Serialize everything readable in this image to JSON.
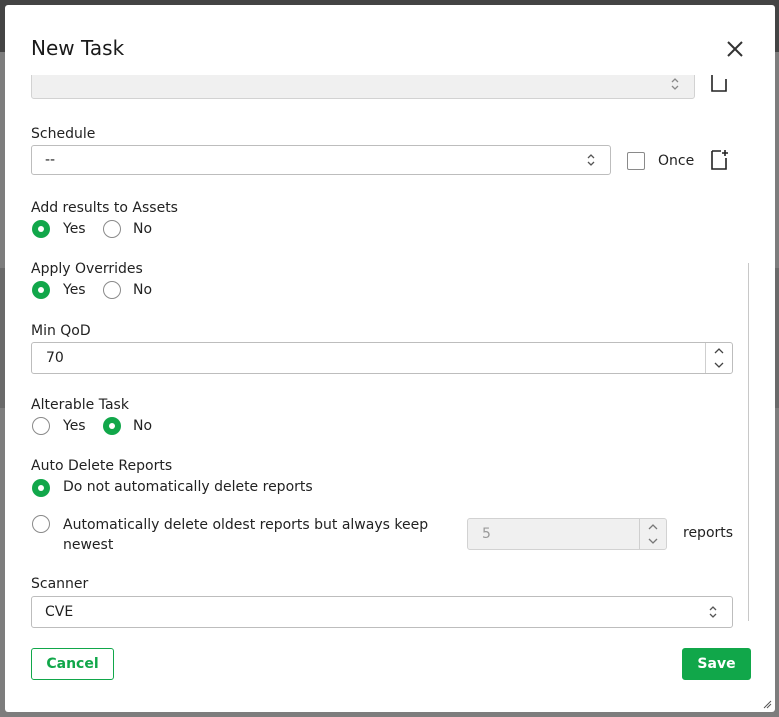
{
  "dialog": {
    "title": "New Task",
    "close_icon": "close-icon"
  },
  "fields": {
    "top_select": {
      "value": ""
    },
    "schedule": {
      "label": "Schedule",
      "value": "--",
      "once_label": "Once",
      "once_checked": false
    },
    "add_results": {
      "label": "Add results to Assets",
      "yes": "Yes",
      "no": "No",
      "selected": "Yes"
    },
    "apply_overrides": {
      "label": "Apply Overrides",
      "yes": "Yes",
      "no": "No",
      "selected": "Yes"
    },
    "min_qod": {
      "label": "Min QoD",
      "value": "70"
    },
    "alterable": {
      "label": "Alterable Task",
      "yes": "Yes",
      "no": "No",
      "selected": "No"
    },
    "auto_delete": {
      "label": "Auto Delete Reports",
      "option1": "Do not automatically delete reports",
      "option2": "Automatically delete oldest reports but always keep newest",
      "keep_value": "5",
      "reports_suffix": "reports",
      "selected": "option1"
    },
    "scanner": {
      "label": "Scanner",
      "value": "CVE"
    }
  },
  "footer": {
    "cancel_label": "Cancel",
    "save_label": "Save"
  },
  "colors": {
    "accent": "#11a74a",
    "overlay": "#7d7d7d"
  }
}
